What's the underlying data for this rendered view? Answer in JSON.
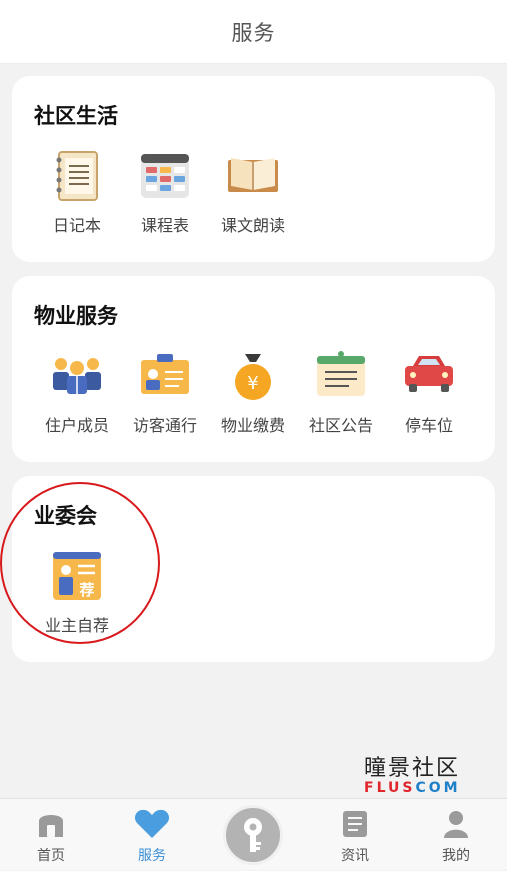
{
  "header": {
    "title": "服务"
  },
  "sections": [
    {
      "title": "社区生活",
      "items": [
        {
          "label": "日记本",
          "icon": "notebook-icon"
        },
        {
          "label": "课程表",
          "icon": "timetable-icon"
        },
        {
          "label": "课文朗读",
          "icon": "open-book-icon"
        }
      ]
    },
    {
      "title": "物业服务",
      "items": [
        {
          "label": "住户成员",
          "icon": "residents-icon"
        },
        {
          "label": "访客通行",
          "icon": "visitor-badge-icon"
        },
        {
          "label": "物业缴费",
          "icon": "money-bag-icon"
        },
        {
          "label": "社区公告",
          "icon": "notice-board-icon"
        },
        {
          "label": "停车位",
          "icon": "car-icon"
        }
      ]
    },
    {
      "title": "业委会",
      "items": [
        {
          "label": "业主自荐",
          "icon": "self-recommend-icon",
          "icon_text": "荐"
        }
      ]
    }
  ],
  "watermark": {
    "chinese": "曈景社区",
    "english_red": "FLUS",
    "english_blue": "COM"
  },
  "tabbar": {
    "tabs": [
      {
        "label": "首页",
        "icon": "home-icon"
      },
      {
        "label": "服务",
        "icon": "heart-icon",
        "active": true
      },
      {
        "label": "",
        "icon": "key-icon"
      },
      {
        "label": "资讯",
        "icon": "news-icon"
      },
      {
        "label": "我的",
        "icon": "profile-icon"
      }
    ]
  },
  "colors": {
    "accent": "#3b8fd6",
    "annotation": "#d8191c",
    "yellow": "#f5b731"
  }
}
